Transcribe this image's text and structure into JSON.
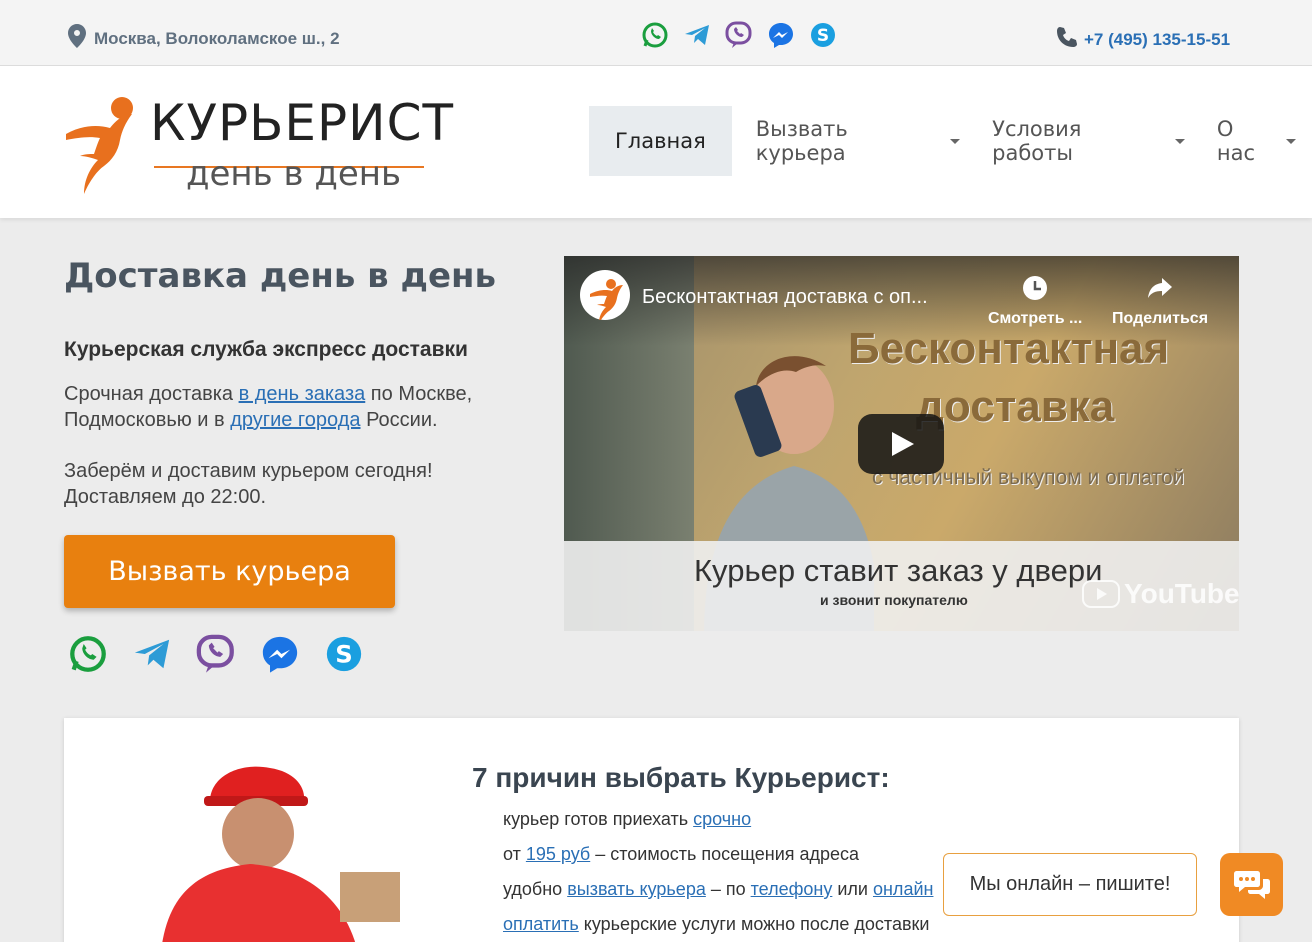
{
  "topbar": {
    "address": "Москва, Волоколамское ш., 2",
    "phone": "+7 (495) 135-15-51",
    "messengers": [
      "whatsapp-icon",
      "telegram-icon",
      "viber-icon",
      "messenger-icon",
      "skype-icon"
    ]
  },
  "logo": {
    "line1": "КУРЬЕРИСТ",
    "line2": "день в день"
  },
  "nav": {
    "items": [
      {
        "label": "Главная",
        "active": true
      },
      {
        "label": "Вызвать курьера",
        "dropdown": true
      },
      {
        "label": "Условия работы",
        "dropdown": true
      },
      {
        "label": "О нас",
        "dropdown": true
      }
    ]
  },
  "hero": {
    "title": "Доставка день в день",
    "subtitle": "Курьерская служба экспресс доставки",
    "p1_a": "Срочная доставка ",
    "p1_link1": "в день заказа",
    "p1_b": " по Москве, Подмосковью и в ",
    "p1_link2": "другие города",
    "p1_c": " России.",
    "p2": "Заберём и доставим курьером сегодня! Доставляем до 22:00.",
    "cta": "Вызвать курьера"
  },
  "video": {
    "title": "Бесконтактная доставка с оп...",
    "watch_later": "Смотреть ...",
    "share": "Поделиться",
    "overlay_line1": "Бесконтактная",
    "overlay_line2": "доставка",
    "overlay_small": "с частичный выкупом и оплатой",
    "caption1": "Курьер ставит заказ у двери",
    "caption2": "и звонит покупателю",
    "youtube": "YouTube"
  },
  "reasons": {
    "title": "7 причин выбрать Курьерист:",
    "r1_a": "курьер готов приехать ",
    "r1_link": "срочно",
    "r2_a": "от ",
    "r2_link": "195 руб",
    "r2_b": " – стоимость посещения адреса",
    "r3_a": "удобно ",
    "r3_link1": "вызвать курьера",
    "r3_b": " – по ",
    "r3_link2": "телефону",
    "r3_c": " или ",
    "r3_link3": "онлайн",
    "r4_link": "оплатить",
    "r4_b": " курьерские услуги можно после доставки"
  },
  "chat": {
    "bubble": "Мы онлайн – пишите!"
  },
  "colors": {
    "accent": "#e8800f",
    "link": "#2a6fb5"
  }
}
